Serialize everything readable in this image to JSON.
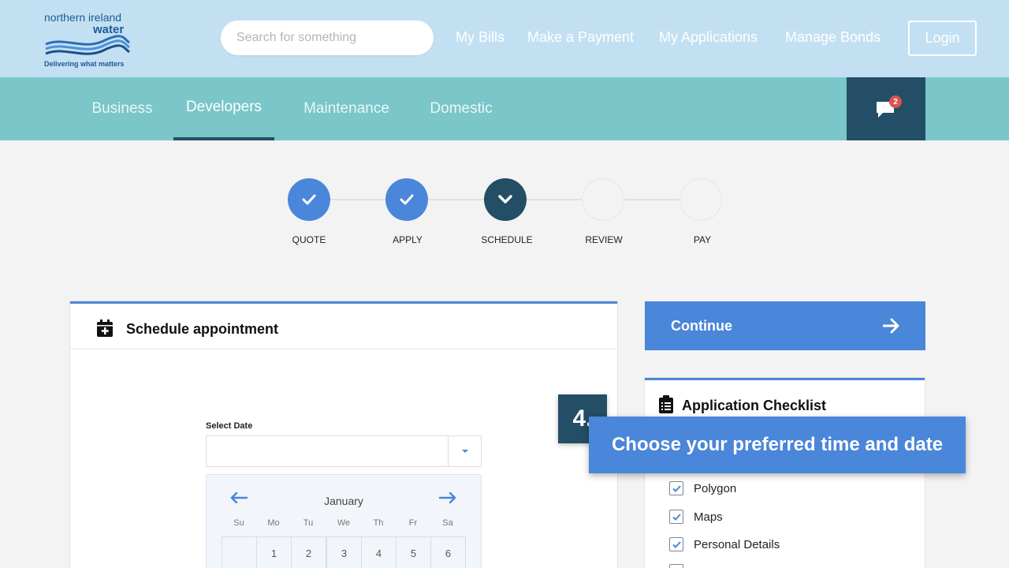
{
  "brand": {
    "name_line1": "northern ireland",
    "name_line2": "water",
    "tagline": "Delivering what matters"
  },
  "search": {
    "placeholder": "Search for something",
    "value": ""
  },
  "top_nav": {
    "items": [
      "My Bills",
      "Make a Payment",
      "My Applications",
      "Manage Bonds"
    ],
    "login_label": "Login"
  },
  "sub_nav": {
    "tabs": [
      {
        "label": "Business",
        "active": false
      },
      {
        "label": "Developers",
        "active": true
      },
      {
        "label": "Maintenance",
        "active": false
      },
      {
        "label": "Domestic",
        "active": false
      }
    ],
    "chat_badge": "2"
  },
  "stepper": {
    "steps": [
      {
        "label": "QUOTE",
        "state": "done"
      },
      {
        "label": "APPLY",
        "state": "done"
      },
      {
        "label": "SCHEDULE",
        "state": "current"
      },
      {
        "label": "REVIEW",
        "state": "todo"
      },
      {
        "label": "PAY",
        "state": "todo"
      }
    ]
  },
  "schedule": {
    "title": "Schedule appointment",
    "select_date_label": "Select Date",
    "selected_date": "",
    "calendar": {
      "month": "January",
      "weekdays": [
        "Su",
        "Mo",
        "Tu",
        "We",
        "Th",
        "Fr",
        "Sa"
      ],
      "first_row": [
        "",
        "1",
        "2",
        "3",
        "4",
        "5",
        "6"
      ]
    }
  },
  "continue_label": "Continue",
  "checklist": {
    "title": "Application Checklist",
    "items": [
      {
        "label": "Polygon",
        "checked": true
      },
      {
        "label": "Maps",
        "checked": true
      },
      {
        "label": "Personal Details",
        "checked": true
      }
    ]
  },
  "overlay": {
    "step_number": "4.",
    "caption": "Choose your preferred time and date"
  },
  "colors": {
    "header_bg": "#c3e0f2",
    "subnav_bg": "#7ac6c9",
    "dark_accent": "#234e66",
    "primary": "#4a86d9",
    "badge": "#d9534f"
  }
}
